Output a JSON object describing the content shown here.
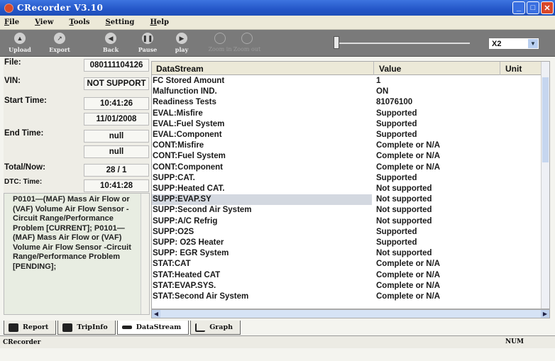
{
  "window": {
    "title": "CRecorder V3.10"
  },
  "menu": [
    "File",
    "View",
    "Tools",
    "Setting",
    "Help"
  ],
  "toolbar": {
    "buttons": [
      {
        "label": "Upload",
        "icon": "upload-icon"
      },
      {
        "label": "Export",
        "icon": "export-icon"
      },
      {
        "label": "Back",
        "icon": "back-icon"
      },
      {
        "label": "Pause",
        "icon": "pause-icon"
      },
      {
        "label": "play",
        "icon": "play-icon"
      },
      {
        "label": "Zoom in",
        "icon": "zoom-in-icon"
      },
      {
        "label": "Zoom out",
        "icon": "zoom-out-icon"
      }
    ],
    "speed": "X2",
    "playback_position": 0.02
  },
  "info": {
    "file_label": "File:",
    "file": "080111104126",
    "vin_label": "VIN:",
    "vin": "NOT SUPPORT",
    "start_label": "Start Time:",
    "start_time": "10:41:26",
    "start_date": "11/01/2008",
    "end_label": "End Time:",
    "end_time": "null",
    "end_date": "null",
    "total_label": "Total/Now:",
    "total": "28 / 1",
    "dtc_time_label": "DTC: Time:",
    "dtc_time": "10:41:28",
    "dtc_text": "P0101—(MAF) Mass Air Flow or (VAF) Volume Air Flow Sensor -Circuit Range/Performance Problem [CURRENT]; P0101—(MAF) Mass Air Flow or (VAF) Volume Air Flow Sensor -Circuit Range/Performance Problem [PENDING];"
  },
  "table": {
    "headers": [
      "DataStream",
      "Value",
      "Unit"
    ],
    "rows": [
      [
        "FC Stored Amount",
        "1"
      ],
      [
        "Malfunction IND.",
        "ON"
      ],
      [
        "Readiness Tests",
        "81076100"
      ],
      [
        "EVAL:Misfire",
        "Supported"
      ],
      [
        "EVAL:Fuel System",
        "Supported"
      ],
      [
        "EVAL:Component",
        "Supported"
      ],
      [
        "CONT:Misfire",
        "Complete or N/A"
      ],
      [
        "CONT:Fuel System",
        "Complete or N/A"
      ],
      [
        "CONT:Component",
        "Complete or N/A"
      ],
      [
        "SUPP:CAT.",
        "Supported"
      ],
      [
        "SUPP:Heated CAT.",
        "Not supported"
      ],
      [
        "SUPP:EVAP.SY",
        "Not supported"
      ],
      [
        "SUPP:Second Air System",
        "Not supported"
      ],
      [
        "SUPP:A/C Refrig",
        "Not supported"
      ],
      [
        "SUPP:O2S",
        "Supported"
      ],
      [
        "SUPP: O2S Heater",
        "Supported"
      ],
      [
        "SUPP: EGR System",
        "Not supported"
      ],
      [
        "STAT:CAT",
        "Complete or N/A"
      ],
      [
        "STAT:Heated CAT",
        "Complete or N/A"
      ],
      [
        "STAT:EVAP.SYS.",
        "Complete or N/A"
      ],
      [
        "STAT:Second Air System",
        "Complete or N/A"
      ]
    ]
  },
  "tabs": [
    "Report",
    "TripInfo",
    "DataStream",
    "Graph"
  ],
  "status": {
    "app": "CRecorder",
    "num": "NUM"
  }
}
